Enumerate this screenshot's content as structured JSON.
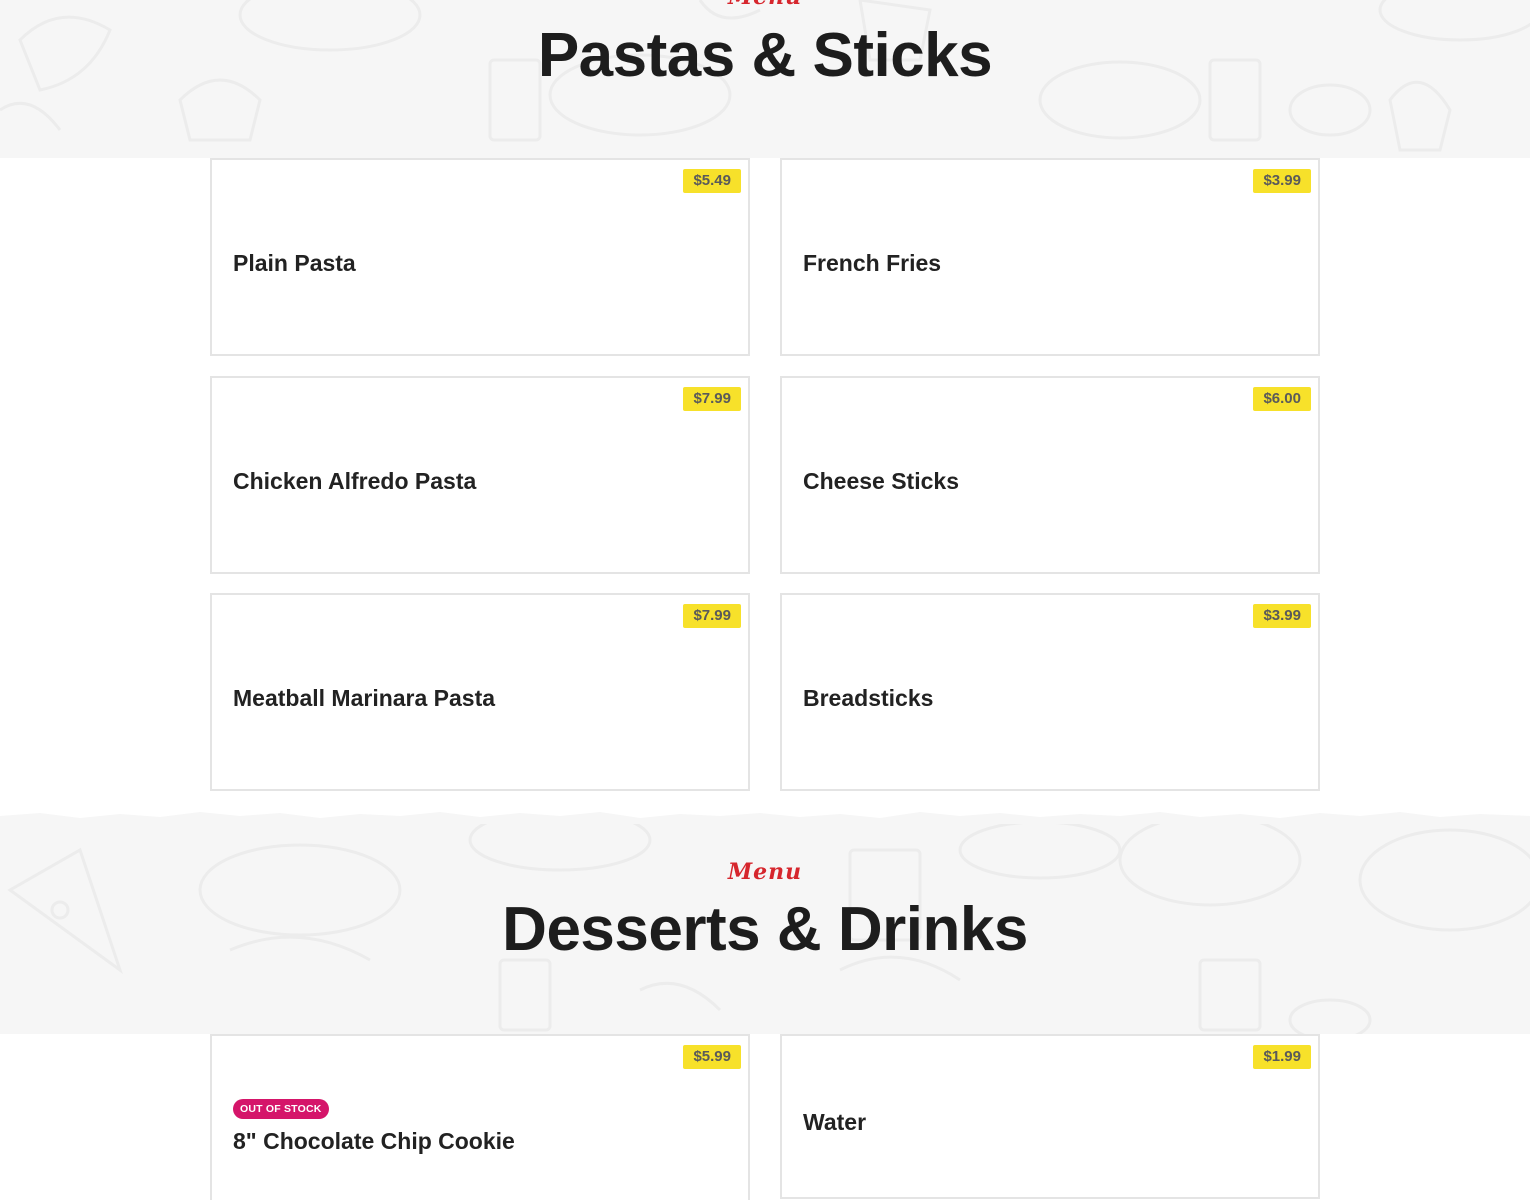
{
  "sections": [
    {
      "kicker": "Menu",
      "title": "Pastas & Sticks",
      "items": [
        {
          "name": "Plain Pasta",
          "price": "$5.49"
        },
        {
          "name": "French Fries",
          "price": "$3.99"
        },
        {
          "name": "Chicken Alfredo Pasta",
          "price": "$7.99"
        },
        {
          "name": "Cheese Sticks",
          "price": "$6.00"
        },
        {
          "name": "Meatball Marinara Pasta",
          "price": "$7.99"
        },
        {
          "name": "Breadsticks",
          "price": "$3.99"
        }
      ]
    },
    {
      "kicker": "Menu",
      "title": "Desserts & Drinks",
      "items": [
        {
          "name": "8\" Chocolate Chip Cookie",
          "price": "$5.99",
          "badge": "OUT OF STOCK"
        },
        {
          "name": "Water",
          "price": "$1.99"
        }
      ]
    }
  ],
  "colors": {
    "accent_red": "#d6262d",
    "price_tag": "#f7e12a",
    "badge_pink": "#d5156a",
    "section_bg": "#f6f6f6"
  }
}
